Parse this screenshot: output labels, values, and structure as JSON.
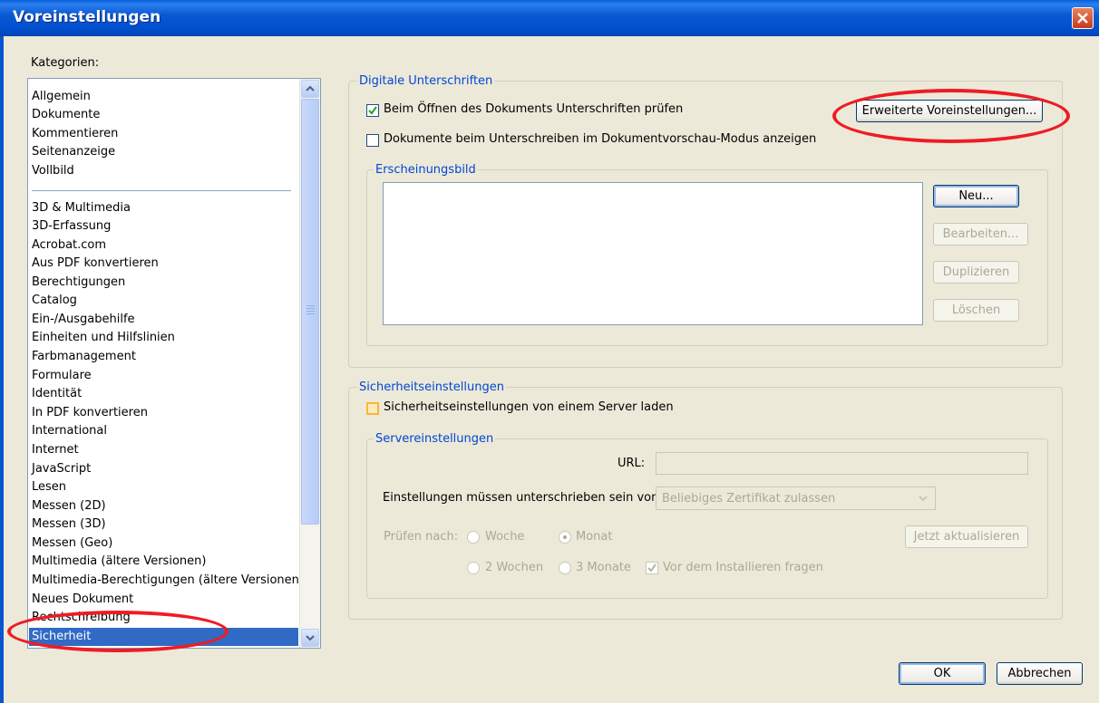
{
  "window": {
    "title": "Voreinstellungen"
  },
  "categories": {
    "label": "Kategorien:",
    "group1": [
      "Allgemein",
      "Dokumente",
      "Kommentieren",
      "Seitenanzeige",
      "Vollbild"
    ],
    "group2": [
      "3D & Multimedia",
      "3D-Erfassung",
      "Acrobat.com",
      "Aus PDF konvertieren",
      "Berechtigungen",
      "Catalog",
      "Ein-/Ausgabehilfe",
      "Einheiten und Hilfslinien",
      "Farbmanagement",
      "Formulare",
      "Identität",
      "In PDF konvertieren",
      "International",
      "Internet",
      "JavaScript",
      "Lesen",
      "Messen (2D)",
      "Messen (3D)",
      "Messen (Geo)",
      "Multimedia (ältere Versionen)",
      "Multimedia-Berechtigungen (ältere Versionen)",
      "Neues Dokument",
      "Rechtschreibung"
    ],
    "selected": "Sicherheit"
  },
  "digital_signatures": {
    "title": "Digitale Unterschriften",
    "verify_on_open": {
      "label": "Beim Öffnen des Dokuments Unterschriften prüfen",
      "checked": true
    },
    "preview_mode": {
      "label": "Dokumente beim Unterschreiben im Dokumentvorschau-Modus anzeigen",
      "checked": false
    },
    "advanced_button": "Erweiterte Voreinstellungen...",
    "appearance": {
      "title": "Erscheinungsbild",
      "new_button": "Neu...",
      "edit_button": "Bearbeiten...",
      "duplicate_button": "Duplizieren",
      "delete_button": "Löschen"
    }
  },
  "security_settings": {
    "title": "Sicherheitseinstellungen",
    "load_from_server": {
      "label": "Sicherheitseinstellungen von einem Server laden",
      "checked": false
    },
    "server": {
      "title": "Servereinstellungen",
      "url_label": "URL:",
      "url_value": "",
      "signed_by_label": "Einstellungen müssen unterschrieben sein von:",
      "signed_by_value": "Beliebiges Zertifikat zulassen",
      "check_every_label": "Prüfen nach:",
      "options": [
        "Woche",
        "Monat",
        "2 Wochen",
        "3 Monate"
      ],
      "selected_option": "Monat",
      "update_now_button": "Jetzt aktualisieren",
      "ask_before_install": {
        "label": "Vor dem Installieren fragen",
        "checked": true
      }
    }
  },
  "footer": {
    "ok": "OK",
    "cancel": "Abbrechen"
  },
  "colors": {
    "title_bar": "#0b5ad3",
    "selection": "#316ac5",
    "group_title": "#0046d5",
    "annotation": "#ee1c24"
  }
}
